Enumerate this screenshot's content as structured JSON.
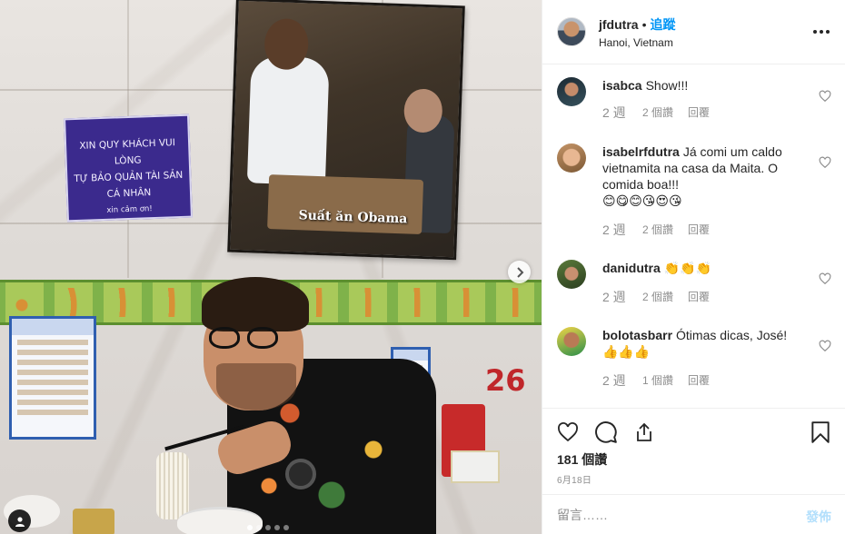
{
  "photo": {
    "sign_lines": [
      "XIN QUY KHÁCH VUI LÒNG",
      "TỰ BẢO QUẢN TÀI SẢN CÁ NHÂN",
      "xin cảm ơn!"
    ],
    "frame_caption": "Suất ăn Obama",
    "table_number": "26",
    "carousel_count": 5,
    "carousel_active": 0
  },
  "header": {
    "username": "jfdutra",
    "bullet": "•",
    "follow_label": "追蹤",
    "location": "Hanoi, Vietnam"
  },
  "comments": [
    {
      "username": "isabca",
      "text": "Show!!!",
      "time": "2 週",
      "likes": "2 個讚",
      "reply": "回覆"
    },
    {
      "username": "isabelrfdutra",
      "text": "Já comi um caldo vietnamita na casa da Maita. O comida boa!!!",
      "emoji": "😊😋😊😘😍😘",
      "time": "2 週",
      "likes": "2 個讚",
      "reply": "回覆"
    },
    {
      "username": "danidutra",
      "text": "",
      "emoji": "👏👏👏",
      "time": "2 週",
      "likes": "2 個讚",
      "reply": "回覆"
    },
    {
      "username": "bolotasbarr",
      "text": "Ótimas dicas, José!",
      "emoji": "👍👍👍",
      "time": "2 週",
      "likes": "1 個讚",
      "reply": "回覆"
    }
  ],
  "actions": {
    "like_count": "181 個讚",
    "date": "6月18日"
  },
  "add_comment": {
    "placeholder": "留言……",
    "post_label": "發佈"
  },
  "colors": {
    "link_blue": "#0095f6",
    "post_disabled": "#b2dffc",
    "muted_text": "#8e8e8e"
  },
  "icons": [
    "heart-icon",
    "comment-icon",
    "share-icon",
    "bookmark-icon",
    "more-icon",
    "chevron-right-icon",
    "user-tag-icon"
  ]
}
